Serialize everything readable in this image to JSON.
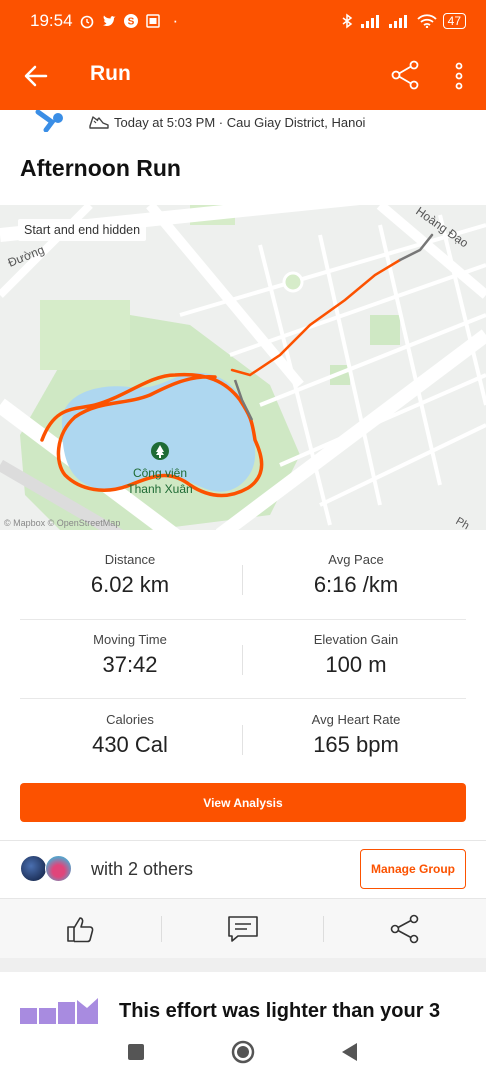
{
  "status_bar": {
    "time": "19:54",
    "battery": "47",
    "left_icons": [
      "alarm-icon",
      "twitter-icon",
      "app-icon",
      "image-icon",
      "dot-icon"
    ],
    "right_icons": [
      "bluetooth-icon",
      "signal-icon",
      "signal-icon",
      "wifi-icon",
      "battery-icon"
    ]
  },
  "app_bar": {
    "title": "Run",
    "back_icon": "arrow-left-icon",
    "share_icon": "share-icon",
    "more_icon": "more-vertical-icon"
  },
  "activity": {
    "meta": "Today at 5:03 PM · Cau Giay District, Hanoi",
    "title": "Afternoon Run"
  },
  "map": {
    "notice": "Start and end hidden",
    "attribution": "© Mapbox © OpenStreetMap",
    "labels": [
      "Đường",
      "Hoàng Đạo",
      "Công viên",
      "Thanh Xuân",
      "Ph"
    ],
    "route_color": "#fc5200"
  },
  "stats": [
    {
      "label": "Distance",
      "value": "6.02 km"
    },
    {
      "label": "Avg Pace",
      "value": "6:16 /km"
    },
    {
      "label": "Moving Time",
      "value": "37:42"
    },
    {
      "label": "Elevation Gain",
      "value": "100 m"
    },
    {
      "label": "Calories",
      "value": "430 Cal"
    },
    {
      "label": "Avg Heart Rate",
      "value": "165 bpm"
    }
  ],
  "buttons": {
    "view_analysis": "View Analysis",
    "manage_group": "Manage Group"
  },
  "group": {
    "with_text": "with 2 others"
  },
  "actions": [
    "thumbs-up-icon",
    "comment-icon",
    "share-icon"
  ],
  "insight": {
    "text": "This effort was lighter than your 3"
  },
  "colors": {
    "brand": "#fc5200",
    "park": "#cfe8c4",
    "water": "#aed7f0"
  }
}
